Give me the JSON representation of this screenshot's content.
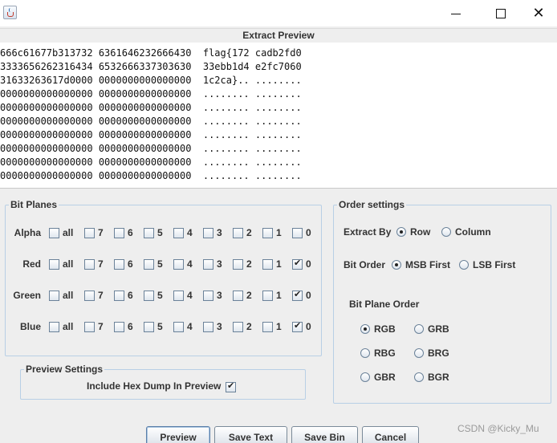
{
  "window": {
    "title": "",
    "app_icon": "java-cup-icon",
    "controls": {
      "minimize": "minimize-icon",
      "maximize": "maximize-icon",
      "close": "✕"
    }
  },
  "preview": {
    "title": "Extract Preview",
    "lines": [
      "666c61677b313732 6361646232666430  flag{172 cadb2fd0",
      "3333656262316434 6532666337303630  33ebb1d4 e2fc7060",
      "31633263617d0000 0000000000000000  1c2ca}.. ........",
      "0000000000000000 0000000000000000  ........ ........",
      "0000000000000000 0000000000000000  ........ ........",
      "0000000000000000 0000000000000000  ........ ........",
      "0000000000000000 0000000000000000  ........ ........",
      "0000000000000000 0000000000000000  ........ ........",
      "0000000000000000 0000000000000000  ........ ........",
      "0000000000000000 0000000000000000  ........ ........"
    ]
  },
  "bit_planes": {
    "legend": "Bit Planes",
    "bit_labels": [
      "all",
      "7",
      "6",
      "5",
      "4",
      "3",
      "2",
      "1",
      "0"
    ],
    "rows": [
      {
        "name": "Alpha",
        "checked": []
      },
      {
        "name": "Red",
        "checked": [
          "0"
        ]
      },
      {
        "name": "Green",
        "checked": [
          "0"
        ]
      },
      {
        "name": "Blue",
        "checked": [
          "0"
        ]
      }
    ]
  },
  "order_settings": {
    "legend": "Order settings",
    "extract_by": {
      "label": "Extract By",
      "options": [
        "Row",
        "Column"
      ],
      "selected": "Row"
    },
    "bit_order": {
      "label": "Bit Order",
      "options": [
        "MSB First",
        "LSB First"
      ],
      "selected": "MSB First"
    },
    "bit_plane_order": {
      "label": "Bit Plane Order",
      "options": [
        "RGB",
        "GRB",
        "RBG",
        "BRG",
        "GBR",
        "BGR"
      ],
      "selected": "RGB"
    }
  },
  "preview_settings": {
    "legend": "Preview Settings",
    "hex_dump_label": "Include Hex Dump In Preview",
    "hex_dump_checked": true
  },
  "buttons": {
    "preview": "Preview",
    "save_text": "Save Text",
    "save_bin": "Save Bin",
    "cancel": "Cancel"
  },
  "watermark": "CSDN @Kicky_Mu"
}
